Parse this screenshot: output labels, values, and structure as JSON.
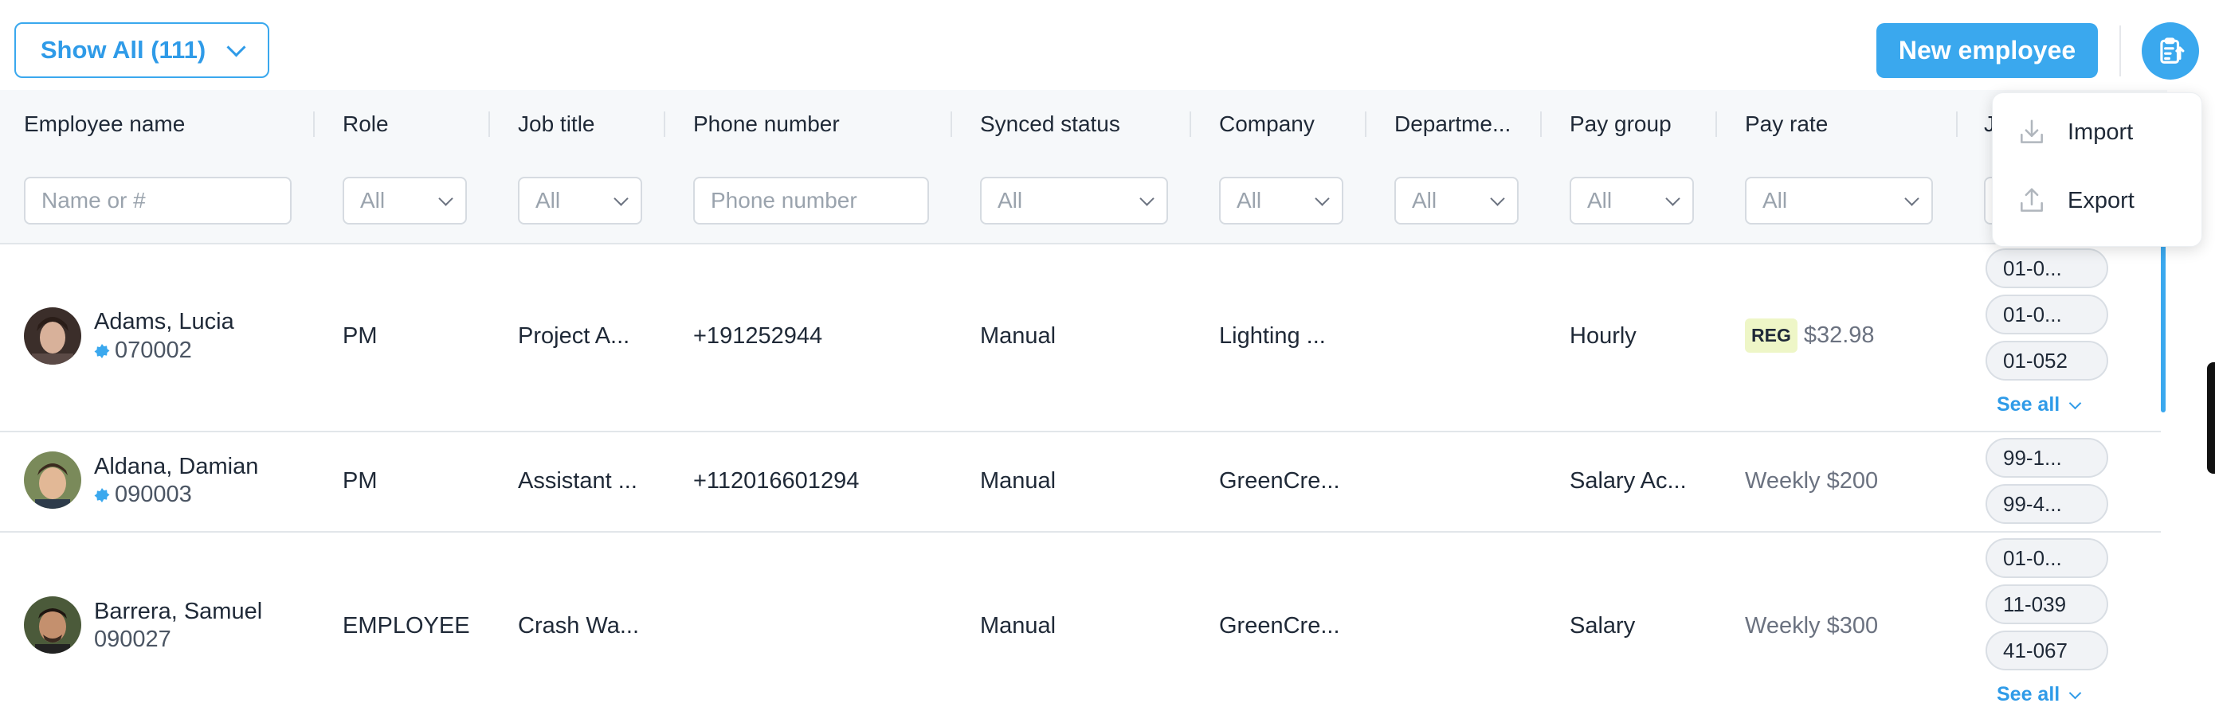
{
  "toolbar": {
    "show_all_label": "Show All (111)",
    "new_employee_label": "New employee",
    "tools_icon": "clipboard-list-icon",
    "accent_color": "#3aa8ee"
  },
  "columns": {
    "employee_name": "Employee name",
    "role": "Role",
    "job_title": "Job title",
    "phone_number": "Phone number",
    "synced_status": "Synced status",
    "company": "Company",
    "department": "Departme...",
    "pay_group": "Pay group",
    "pay_rate": "Pay rate",
    "jobs_partial": "J"
  },
  "filters": {
    "name_placeholder": "Name or #",
    "role": "All",
    "job_title": "All",
    "phone_placeholder": "Phone number",
    "synced_status": "All",
    "company": "All",
    "department": "All",
    "pay_group": "All",
    "pay_rate": "All"
  },
  "menu": {
    "import_label": "Import",
    "export_label": "Export"
  },
  "rows": [
    {
      "name": "Adams, Lucia",
      "id": "070002",
      "synced": true,
      "role": "PM",
      "job_title": "Project A...",
      "phone": "+191252944",
      "status": "Manual",
      "company": "Lighting ...",
      "department": "",
      "pay_group": "Hourly",
      "pay_badge": "REG",
      "pay_rate": "$32.98",
      "jobs": [
        "01-0...",
        "01-0...",
        "01-052"
      ],
      "see_all": "See all"
    },
    {
      "name": "Aldana, Damian",
      "id": "090003",
      "synced": true,
      "role": "PM",
      "job_title": "Assistant ...",
      "phone": "+112016601294",
      "status": "Manual",
      "company": "GreenCre...",
      "department": "",
      "pay_group": "Salary Ac...",
      "pay_rate": "Weekly $200",
      "jobs": [
        "99-1...",
        "99-4..."
      ]
    },
    {
      "name": "Barrera, Samuel",
      "id": "090027",
      "synced": false,
      "role": "EMPLOYEE",
      "job_title": "Crash Wa...",
      "phone": "",
      "status": "Manual",
      "company": "GreenCre...",
      "department": "",
      "pay_group": "Salary",
      "pay_rate": "Weekly $300",
      "jobs": [
        "01-0...",
        "11-039",
        "41-067"
      ],
      "see_all": "See all"
    }
  ]
}
